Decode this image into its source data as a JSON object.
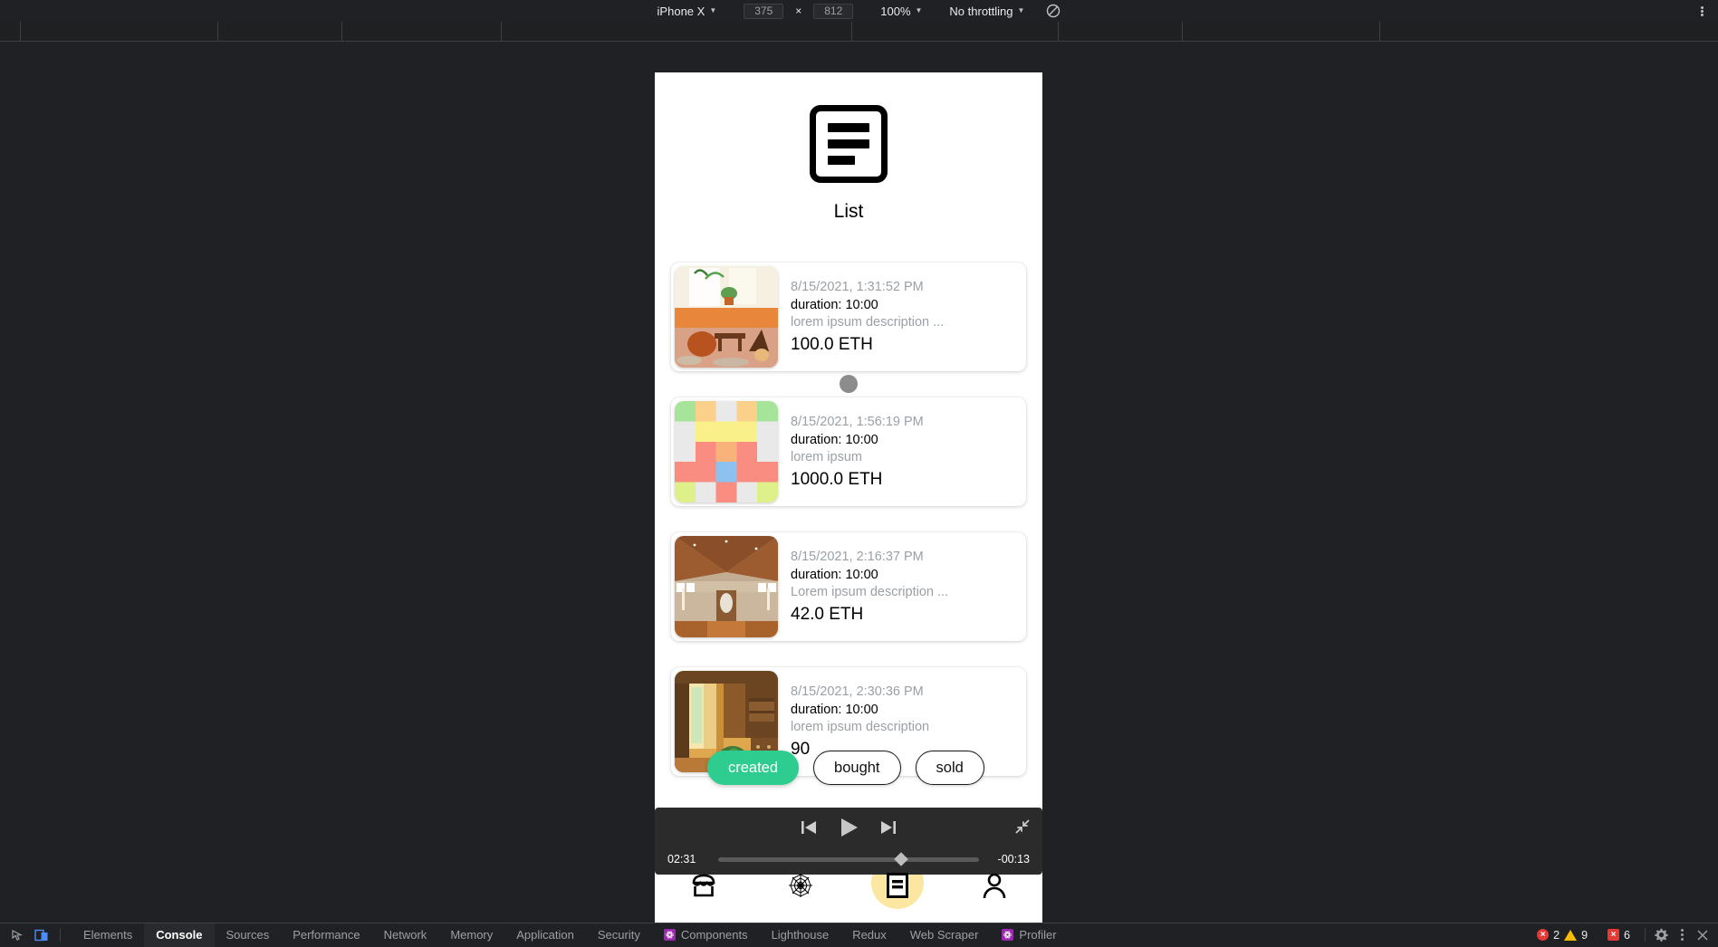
{
  "device_toolbar": {
    "device": "iPhone X",
    "width": "375",
    "height": "812",
    "x_sep": "×",
    "zoom": "100%",
    "throttling": "No throttling",
    "icons": {
      "no_throttle": "no-throttling-icon",
      "kebab": "more-options-icon"
    }
  },
  "app": {
    "title": "List",
    "icon": "list-icon",
    "cards": [
      {
        "date": "8/15/2021, 1:31:52 PM",
        "duration": "duration: 10:00",
        "description": "lorem ipsum description ...",
        "price": "100.0 ETH",
        "thumb": "living-room-photo"
      },
      {
        "date": "8/15/2021, 1:56:19 PM",
        "duration": "duration: 10:00",
        "description": "lorem ipsum",
        "price": "1000.0 ETH",
        "thumb": "pixel-art-nft"
      },
      {
        "date": "8/15/2021, 2:16:37 PM",
        "duration": "duration: 10:00",
        "description": "Lorem ipsum description ...",
        "price": "42.0 ETH",
        "thumb": "wooden-hallway-photo"
      },
      {
        "date": "8/15/2021, 2:30:36 PM",
        "duration": "duration: 10:00",
        "description": "lorem ipsum description",
        "price": "90",
        "thumb": "curtain-room-photo"
      }
    ],
    "filter_pills": [
      {
        "label": "created",
        "state": "active"
      },
      {
        "label": "bought",
        "state": "inactive"
      },
      {
        "label": "sold",
        "state": "inactive"
      }
    ],
    "tabbar": [
      {
        "name": "store-icon",
        "active": false
      },
      {
        "name": "spiderweb-icon",
        "active": false
      },
      {
        "name": "list-icon",
        "active": true
      },
      {
        "name": "person-icon",
        "active": false
      }
    ]
  },
  "player": {
    "elapsed": "02:31",
    "remaining": "-00:13",
    "progress_percent": 70,
    "controls": {
      "previous": "previous-track-icon",
      "play": "play-icon",
      "next": "next-track-icon",
      "minimize": "minimize-icon"
    }
  },
  "devtools": {
    "tabs": [
      {
        "label": "Elements",
        "active": false,
        "icon": null
      },
      {
        "label": "Console",
        "active": true,
        "icon": null
      },
      {
        "label": "Sources",
        "active": false,
        "icon": null
      },
      {
        "label": "Performance",
        "active": false,
        "icon": null
      },
      {
        "label": "Network",
        "active": false,
        "icon": null
      },
      {
        "label": "Memory",
        "active": false,
        "icon": null
      },
      {
        "label": "Application",
        "active": false,
        "icon": null
      },
      {
        "label": "Security",
        "active": false,
        "icon": null
      },
      {
        "label": "Components",
        "active": false,
        "icon": "react-icon"
      },
      {
        "label": "Lighthouse",
        "active": false,
        "icon": null
      },
      {
        "label": "Redux",
        "active": false,
        "icon": null
      },
      {
        "label": "Web Scraper",
        "active": false,
        "icon": null
      },
      {
        "label": "Profiler",
        "active": false,
        "icon": "react-icon"
      }
    ],
    "status": {
      "errors": "2",
      "warnings": "9",
      "issues": "6"
    },
    "right_icons": {
      "settings": "gear-icon",
      "more": "more-options-icon",
      "close": "close-icon"
    }
  },
  "colors": {
    "accent_green": "#2ecc8f",
    "devtools_bg": "#202124",
    "highlight_yellow": "#fbe6a2",
    "error_red": "#e53935",
    "warning_yellow": "#fbbc04"
  }
}
